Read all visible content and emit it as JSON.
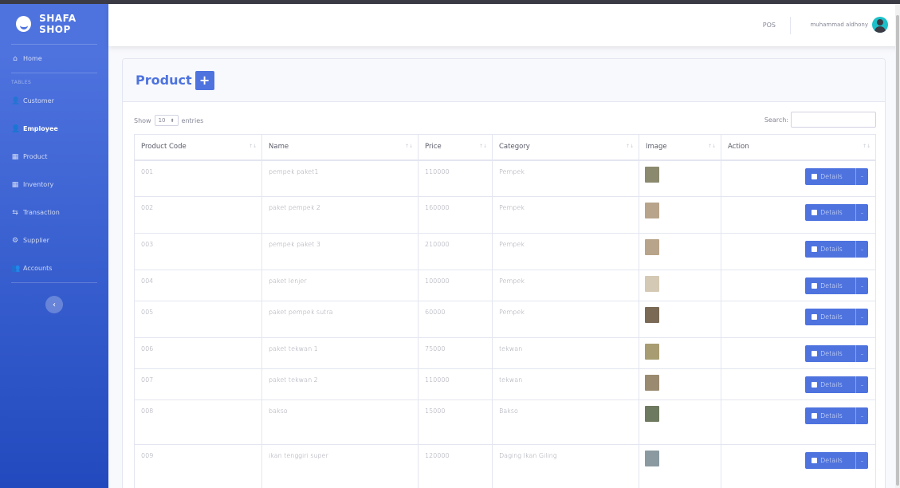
{
  "brand": {
    "name": "SHAFA SHOP"
  },
  "sidebar": {
    "home": "Home",
    "heading": "TABLES",
    "items": [
      {
        "label": "Customer",
        "icon": "user-icon",
        "active": false
      },
      {
        "label": "Employee",
        "icon": "user-icon",
        "active": true
      },
      {
        "label": "Product",
        "icon": "table-icon",
        "active": false
      },
      {
        "label": "Inventory",
        "icon": "table-icon",
        "active": false
      },
      {
        "label": "Transaction",
        "icon": "exchange-icon",
        "active": false
      },
      {
        "label": "Supplier",
        "icon": "cogs-icon",
        "active": false
      },
      {
        "label": "Accounts",
        "icon": "users-icon",
        "active": false
      }
    ],
    "toggle": "‹"
  },
  "topbar": {
    "pos": "POS",
    "user": "muhammad aldhony"
  },
  "card": {
    "title": "Product",
    "add": "+"
  },
  "controls": {
    "show": "Show",
    "entries_value": "10",
    "entries": "entries",
    "search": "Search:"
  },
  "table": {
    "headers": [
      "Product Code",
      "Name",
      "Price",
      "Category",
      "Image",
      "Action"
    ],
    "details_label": "Details",
    "rows": [
      {
        "code": "001",
        "name": "pempek paket1",
        "price": "110000",
        "category": "Pempek",
        "img": "#8c8a6e"
      },
      {
        "code": "002",
        "name": "paket pempek 2",
        "price": "160000",
        "category": "Pempek",
        "img": "#b8a48a"
      },
      {
        "code": "003",
        "name": "pempek paket 3",
        "price": "210000",
        "category": "Pempek",
        "img": "#b8a48a"
      },
      {
        "code": "004",
        "name": "paket lenjer",
        "price": "100000",
        "category": "Pempek",
        "img": "#d4c9b4"
      },
      {
        "code": "005",
        "name": "paket pempek sutra",
        "price": "60000",
        "category": "Pempek",
        "img": "#7a6a55"
      },
      {
        "code": "006",
        "name": "paket tekwan 1",
        "price": "75000",
        "category": "tekwan",
        "img": "#a89c72"
      },
      {
        "code": "007",
        "name": "paket tekwan 2",
        "price": "110000",
        "category": "tekwan",
        "img": "#9a8a70"
      },
      {
        "code": "008",
        "name": "bakso",
        "price": "15000",
        "category": "Bakso",
        "img": "#6e7a60"
      },
      {
        "code": "009",
        "name": "ikan tenggiri super",
        "price": "120000",
        "category": "Daging Ikan Giling",
        "img": "#8a9aa0"
      }
    ]
  }
}
